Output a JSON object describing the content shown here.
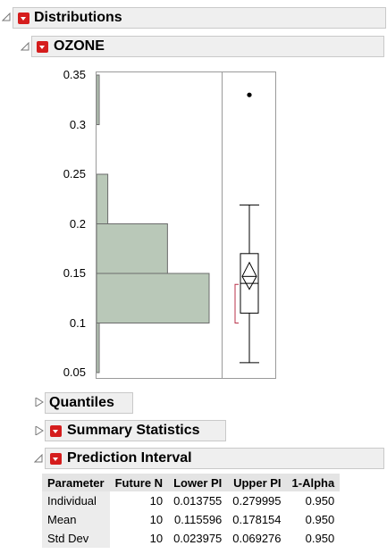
{
  "report": {
    "title": "Distributions"
  },
  "variable": {
    "title": "OZONE"
  },
  "colors": {
    "histogram_fill": "#b9c8b8",
    "hotspot": "#d51d1d",
    "shortest_half_bracket": "#b8324a",
    "header_bg": "#efefef"
  },
  "chart_data": {
    "type": "histogram",
    "orientation": "vertical",
    "y_ticks": [
      "0.35",
      "0.3",
      "0.25",
      "0.2",
      "0.15",
      "0.1",
      "0.05"
    ],
    "ylim": [
      0.05,
      0.35
    ],
    "bins": [
      {
        "from": 0.05,
        "to": 0.1,
        "relative_count": 0.02
      },
      {
        "from": 0.1,
        "to": 0.15,
        "relative_count": 1.0
      },
      {
        "from": 0.15,
        "to": 0.2,
        "relative_count": 0.63
      },
      {
        "from": 0.2,
        "to": 0.25,
        "relative_count": 0.1
      },
      {
        "from": 0.25,
        "to": 0.3,
        "relative_count": 0.0
      },
      {
        "from": 0.3,
        "to": 0.35,
        "relative_count": 0.02
      }
    ],
    "box_plot": {
      "whisker_low": 0.06,
      "q1": 0.11,
      "median": 0.14,
      "q3": 0.17,
      "whisker_high": 0.219,
      "mean": 0.147,
      "mean_ci": [
        0.134,
        0.161
      ],
      "shortest_half": [
        0.1,
        0.139
      ],
      "outliers": [
        0.33
      ]
    }
  },
  "sections": {
    "quantiles": "Quantiles",
    "summary_statistics": "Summary Statistics",
    "prediction_interval": "Prediction Interval"
  },
  "prediction_table": {
    "headers": [
      "Parameter",
      "Future N",
      "Lower PI",
      "Upper PI",
      "1-Alpha"
    ],
    "rows": [
      [
        "Individual",
        "10",
        "0.013755",
        "0.279995",
        "0.950"
      ],
      [
        "Mean",
        "10",
        "0.115596",
        "0.178154",
        "0.950"
      ],
      [
        "Std Dev",
        "10",
        "0.023975",
        "0.069276",
        "0.950"
      ]
    ]
  }
}
